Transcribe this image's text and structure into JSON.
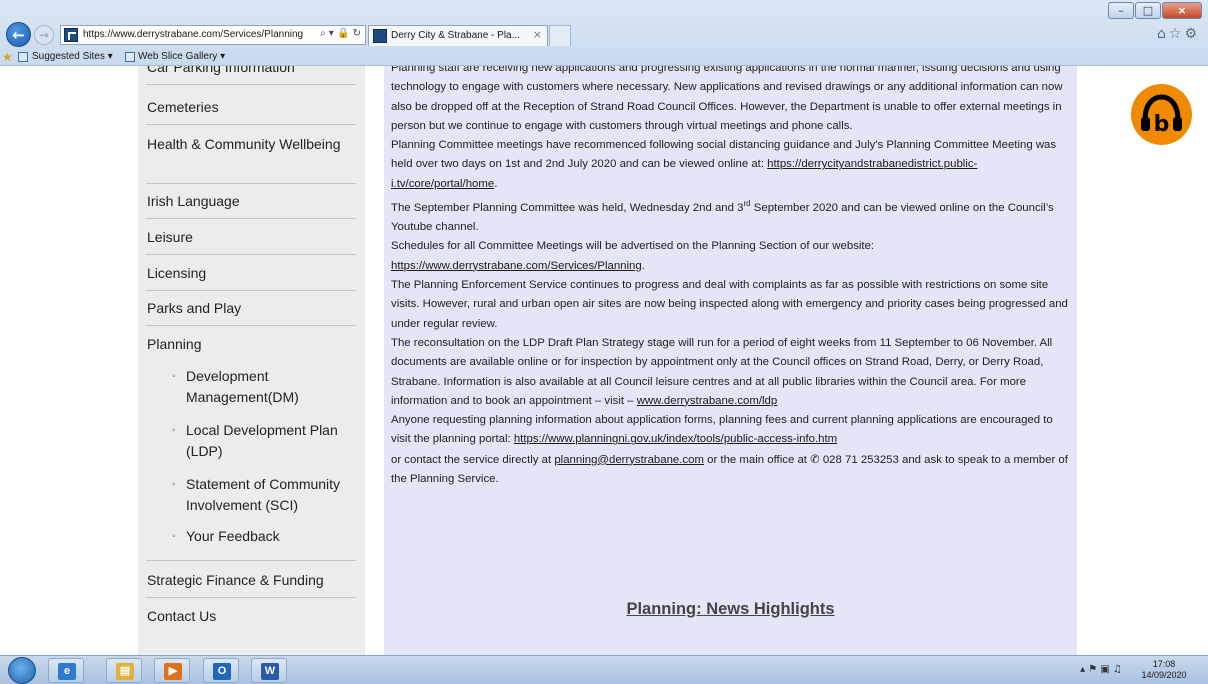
{
  "browser": {
    "address_url": "https://www.derrystrabane.com/Services/Planning",
    "address_tools": "⌕ ▾ 🔒 ↻",
    "tab_title": "Derry City & Strabane - Pla...",
    "tab_close": "×",
    "back_icon": "←",
    "forward_icon": "→",
    "window_controls": {
      "minimize": "–",
      "maximize": "□",
      "close": "×"
    },
    "right_tools": "⌂☆⚙",
    "favorites": {
      "star_icon": "★",
      "suggested_sites": "Suggested Sites ▾",
      "web_slice_gallery": "Web Slice Gallery ▾"
    }
  },
  "sidebar": {
    "items_top": [
      "Car Parking Information",
      "Cemeteries",
      "Health & Community Wellbeing",
      "Irish Language",
      "Leisure",
      "Licensing",
      "Parks and Play",
      "Planning"
    ],
    "sub_items": [
      "Development Management(DM)",
      "Local Development Plan (LDP)",
      "Statement of Community Involvement (SCI)",
      "Your Feedback"
    ],
    "sub_bullet": "◦",
    "items_bottom": [
      "Strategic Finance & Funding",
      "Contact Us"
    ]
  },
  "content": {
    "p1": "Planning staff are receiving new applications and progressing existing applications in the normal manner, issuing decisions and using technology to engage with customers where necessary.  New applications and revised drawings or any additional information can now also be dropped off at the Reception of Strand Road Council Offices. However, the Department is unable to offer external meetings in person but we continue to engage with customers through virtual meetings and phone calls.",
    "p2_text": "Planning Committee meetings have recommenced following social distancing guidance and July's Planning Committee Meeting was held over two days on 1st and 2nd July 2020 and can be viewed online at: ",
    "p2_link": "https://derrycityandstrabanedistrict.public-i.tv/core/portal/home",
    "p2_end": ".",
    "p3_a": "The September Planning Committee was held, Wednesday 2nd and 3",
    "p3_sup": "rd",
    "p3_b": " September 2020 and can be viewed online on the Council’s Youtube channel.",
    "p4_text": "Schedules for all Committee Meetings will be advertised on the Planning Section of our website: ",
    "p4_link": "https://www.derrystrabane.com/Services/Planning",
    "p4_end": ".",
    "p5": "The Planning Enforcement Service continues to progress and deal with complaints as far as possible with restrictions on some site visits.  However, rural and urban open air sites are now being inspected along with emergency and priority cases being progressed and under regular review.",
    "p6_text": "The reconsultation on the LDP Draft Plan Strategy stage will run  for a period of eight weeks from 11 September to 06 November. All documents are available online or for inspection by appointment only at the Council offices on Strand Road, Derry, or Derry Road, Strabane. Information is also available at all Council leisure centres and at all public libraries within the Council area. For more information and to book an appointment – visit – ",
    "p6_link": "www.derrystrabane.com/ldp",
    "p7_text": "Anyone requesting planning information about application forms, planning fees and current planning applications are encouraged to visit the planning portal: ",
    "p7_link": "https://www.planningni.gov.uk/index/tools/public-access-info.htm",
    "p8_a": "or contact the service directly at ",
    "p8_email": "planning@derrystrabane.com",
    "p8_b": " or the main office at ",
    "p8_phone_icon": "✆",
    "p8_c": " 028 71 253253 and ask to speak to a member of the Planning Service.",
    "news_heading": "Planning: News Highlights"
  },
  "listen_button": {
    "letter": "b",
    "color": "#f08a00"
  },
  "taskbar": {
    "apps": [
      "Internet Explorer",
      "Windows Explorer",
      "Media Player",
      "Outlook",
      "Word"
    ],
    "app_glyphs": [
      "e",
      "▤",
      "▶",
      "O",
      "W"
    ],
    "tray_icons": "▴  ⚑  ▣  ♫",
    "time": "17:08",
    "date": "14/09/2020"
  },
  "colors": {
    "sidebar_bg": "#ececec",
    "content_bg": "#e4e5f6",
    "listen_orange": "#f08a00",
    "taskbar": "#b8cde6"
  }
}
